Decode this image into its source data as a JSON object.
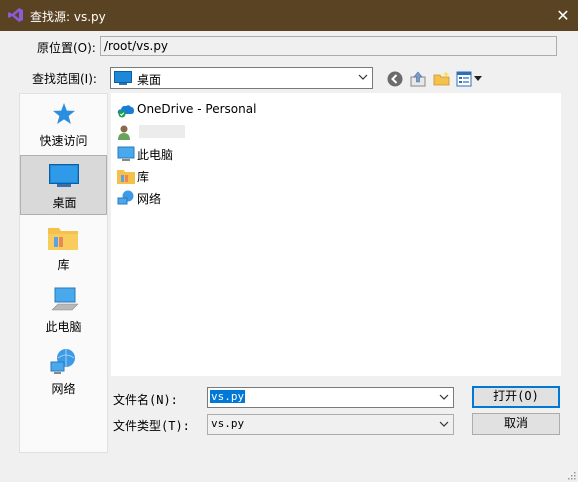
{
  "window": {
    "title": "查找源: vs.py",
    "close_glyph": "✕"
  },
  "location": {
    "label": "原位置(O):",
    "value": "/root/vs.py"
  },
  "look_in": {
    "label": "查找范围(I):",
    "value": "桌面"
  },
  "toolbar": {
    "back_icon": "back-arrow-icon",
    "up_icon": "up-folder-icon",
    "new_folder_icon": "new-folder-icon",
    "view_menu_icon": "view-menu-icon"
  },
  "places": [
    {
      "label": "快速访问",
      "icon": "star-icon"
    },
    {
      "label": "桌面",
      "icon": "desktop-icon",
      "selected": true
    },
    {
      "label": "库",
      "icon": "library-folder-icon"
    },
    {
      "label": "此电脑",
      "icon": "computer-icon"
    },
    {
      "label": "网络",
      "icon": "network-icon"
    }
  ],
  "files": [
    {
      "label": "OneDrive - Personal",
      "icon": "onedrive-icon"
    },
    {
      "label": "",
      "icon": "user-icon"
    },
    {
      "label": "此电脑",
      "icon": "computer-icon"
    },
    {
      "label": "库",
      "icon": "library-folder-icon"
    },
    {
      "label": "网络",
      "icon": "network-icon"
    }
  ],
  "filename": {
    "label": "文件名(N):",
    "value": "vs.py"
  },
  "filetype": {
    "label": "文件类型(T):",
    "value": "vs.py"
  },
  "buttons": {
    "open": "打开(O)",
    "cancel": "取消"
  },
  "colors": {
    "titlebar": "#5a4322",
    "selection": "#0078d7",
    "folder": "#f6c14a",
    "screen": "#1e88d8"
  }
}
